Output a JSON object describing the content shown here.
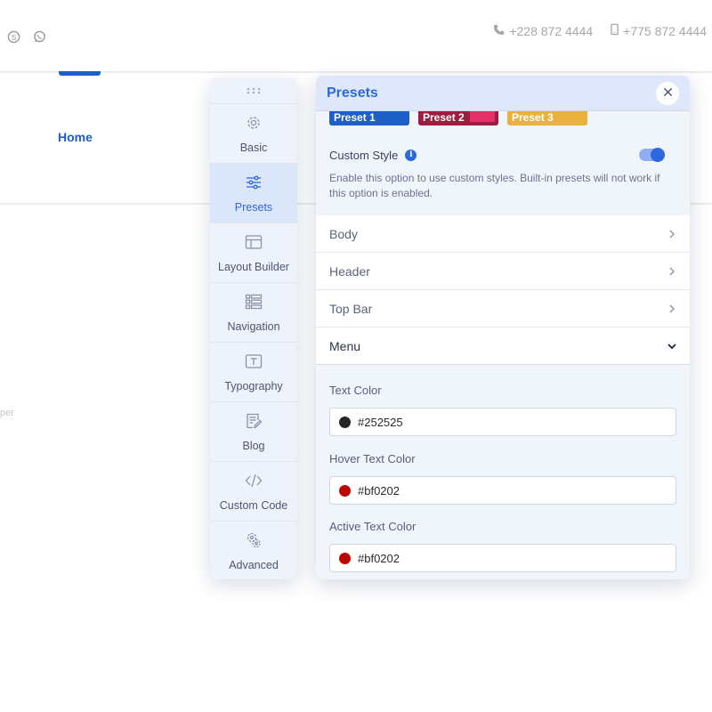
{
  "site": {
    "phone1": "+228 872 4444",
    "phone2": "+775 872 4444",
    "home": "Home",
    "faint_text": "per"
  },
  "sidebar": {
    "items": [
      {
        "label": "Basic",
        "icon": "gear-icon"
      },
      {
        "label": "Presets",
        "icon": "sliders-icon",
        "active": true
      },
      {
        "label": "Layout Builder",
        "icon": "layout-icon"
      },
      {
        "label": "Navigation",
        "icon": "list-icon"
      },
      {
        "label": "Typography",
        "icon": "text-icon"
      },
      {
        "label": "Blog",
        "icon": "blog-icon"
      },
      {
        "label": "Custom Code",
        "icon": "code-icon"
      },
      {
        "label": "Advanced",
        "icon": "advanced-gears-icon"
      }
    ]
  },
  "panel": {
    "title": "Presets",
    "presets": [
      {
        "label": "Preset 1",
        "color": "#1d5ec7"
      },
      {
        "label": "Preset 2",
        "color": "#9c1d3f"
      },
      {
        "label": "Preset 3",
        "color": "#e9b23c"
      }
    ],
    "custom_style": {
      "label": "Custom Style",
      "enabled": true,
      "description": "Enable this option to use custom styles. Built-in presets will not work if this option is enabled."
    },
    "sections": [
      "Body",
      "Header",
      "Top Bar",
      "Menu"
    ],
    "menu": {
      "text_color": {
        "label": "Text Color",
        "value": "#252525"
      },
      "hover_text_color": {
        "label": "Hover Text Color",
        "value": "#bf0202"
      },
      "active_text_color": {
        "label": "Active Text Color",
        "value": "#bf0202"
      }
    }
  }
}
